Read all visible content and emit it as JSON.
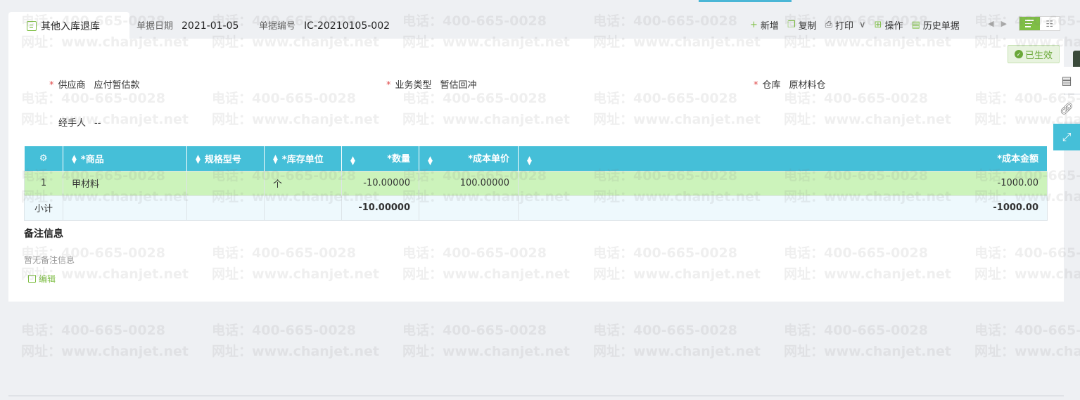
{
  "tab": {
    "title": "其他入库退库"
  },
  "meta": {
    "date_label": "单据日期",
    "date_value": "2021-01-05",
    "code_label": "单据编号",
    "code_value": "IC-20210105-002"
  },
  "toolbar": {
    "new_label": "新增",
    "copy_label": "复制",
    "print_label": "打印",
    "ops_label": "操作",
    "history_label": "历史单据"
  },
  "status": {
    "label": "已生效"
  },
  "fields": {
    "supplier_label": "供应商",
    "supplier_value": "应付暂估款",
    "biztype_label": "业务类型",
    "biztype_value": "暂估回冲",
    "warehouse_label": "仓库",
    "warehouse_value": "原材料仓",
    "handler_label": "经手人",
    "handler_value": "--"
  },
  "table": {
    "headers": [
      "*商品",
      "规格型号",
      "*库存单位",
      "*数量",
      "*成本单价",
      "*成本金额"
    ],
    "rows": [
      {
        "idx": "1",
        "product": "甲材料",
        "spec": "",
        "unit": "个",
        "qty": "-10.00000",
        "price": "100.00000",
        "amount": "-1000.00"
      }
    ],
    "subtotal": {
      "label": "小计",
      "qty": "-10.00000",
      "amount": "-1000.00"
    }
  },
  "remarks": {
    "title": "备注信息",
    "empty": "暂无备注信息",
    "edit_label": "编辑"
  },
  "watermark": {
    "phone": "电话：400-665-0028",
    "site": "网址：www.chanjet.net"
  },
  "colors": {
    "accent": "#45bfd8",
    "green": "#7fbf45",
    "row_highlight": "#ccf3bb"
  }
}
